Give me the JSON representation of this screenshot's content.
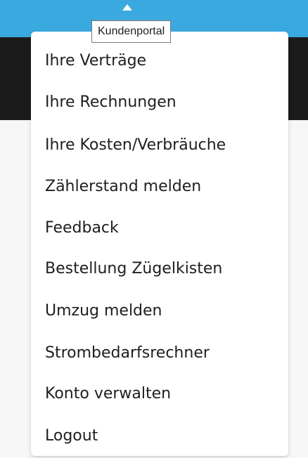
{
  "colors": {
    "accent": "#3aa9e0",
    "header_dark": "#1b1b1b",
    "menu_background": "#ffffff",
    "menu_text": "#1e1e1e"
  },
  "tooltip": {
    "text": "Kundenportal"
  },
  "menu": {
    "items": [
      {
        "label": "Ihre Verträge"
      },
      {
        "label": "Ihre Rechnungen"
      },
      {
        "label": "Ihre Kosten/Verbräuche"
      },
      {
        "label": "Zählerstand melden"
      },
      {
        "label": "Feedback"
      },
      {
        "label": "Bestellung Zügelkisten"
      },
      {
        "label": "Umzug melden"
      },
      {
        "label": "Strombedarfsrechner"
      },
      {
        "label": "Konto verwalten"
      },
      {
        "label": "Logout"
      }
    ]
  }
}
